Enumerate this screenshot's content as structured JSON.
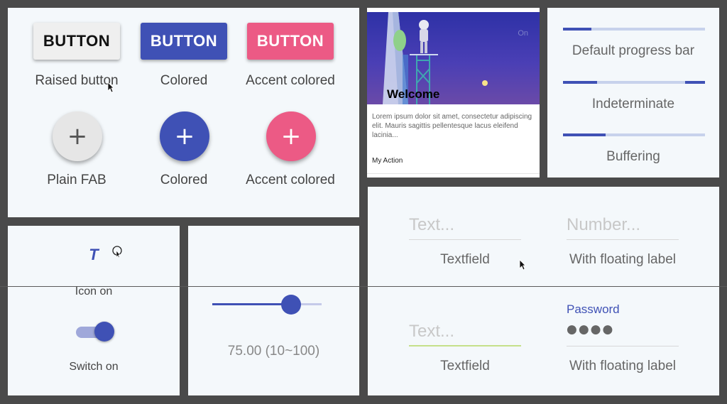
{
  "buttons": {
    "raised_label": "BUTTON",
    "raised_caption": "Raised button",
    "colored_label": "BUTTON",
    "colored_caption": "Colored",
    "accent_label": "BUTTON",
    "accent_caption": "Accent colored"
  },
  "fabs": {
    "plain_symbol": "+",
    "plain_caption": "Plain FAB",
    "colored_symbol": "+",
    "colored_caption": "Colored",
    "accent_symbol": "+",
    "accent_caption": "Accent colored"
  },
  "card": {
    "title": "Welcome",
    "body": "Lorem ipsum dolor sit amet, consectetur adipiscing elit. Mauris sagittis pellentesque lacus eleifend lacinia...",
    "action": "My Action",
    "corner_text": "On"
  },
  "progress": {
    "default_label": "Default progress bar",
    "default_value": 0.2,
    "indeterminate_label": "Indeterminate",
    "buffering_label": "Buffering",
    "buffering_value": 0.3
  },
  "icon_toggle": {
    "icon": "format-italic-icon",
    "glyph": "T",
    "caption": "Icon on"
  },
  "switch": {
    "caption": "Switch on",
    "state": "on"
  },
  "slider": {
    "value_text": "75.00 (10~100)",
    "value": 75,
    "min": 10,
    "max": 100
  },
  "textfields": {
    "tf1_placeholder": "Text...",
    "tf1_caption": "Textfield",
    "tf2_placeholder": "Number...",
    "tf2_caption": "With floating label",
    "tf3_placeholder": "Text...",
    "tf3_caption": "Textfield",
    "tf4_label": "Password",
    "tf4_value": "●●●●",
    "tf4_caption": "With floating label"
  },
  "colors": {
    "primary": "#3f51b5",
    "accent": "#ec5a85",
    "background": "#4a4a4a",
    "panel": "#f4f8fb"
  }
}
